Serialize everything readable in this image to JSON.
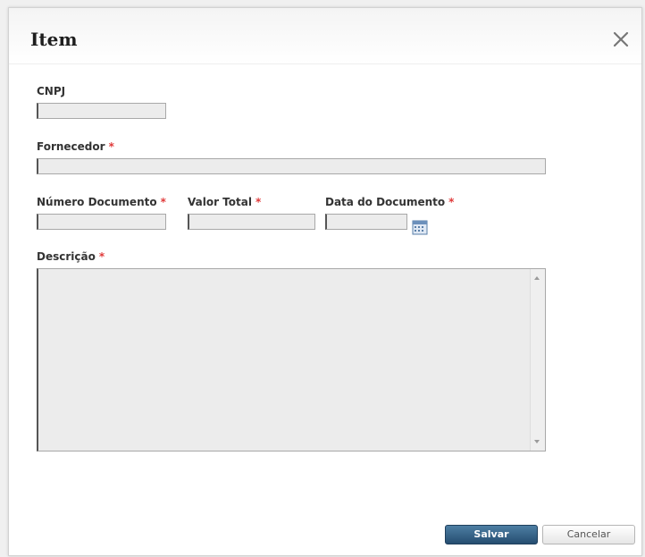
{
  "dialog": {
    "title": "Item",
    "close_label": "×"
  },
  "form": {
    "cnpj": {
      "label": "CNPJ",
      "value": ""
    },
    "fornecedor": {
      "label": "Fornecedor",
      "required_mark": "*",
      "value": ""
    },
    "numero_documento": {
      "label": "Número Documento",
      "required_mark": "*",
      "value": ""
    },
    "valor_total": {
      "label": "Valor Total",
      "required_mark": "*",
      "value": ""
    },
    "data_documento": {
      "label": "Data do Documento",
      "required_mark": "*",
      "value": "",
      "icon": "calendar-icon"
    },
    "descricao": {
      "label": "Descrição",
      "required_mark": "*",
      "value": ""
    }
  },
  "buttons": {
    "save_label": "Salvar",
    "cancel_label": "Cancelar"
  },
  "colors": {
    "required": "#e03a3a",
    "primary_button": "#2f5878",
    "field_background": "#ececec"
  }
}
